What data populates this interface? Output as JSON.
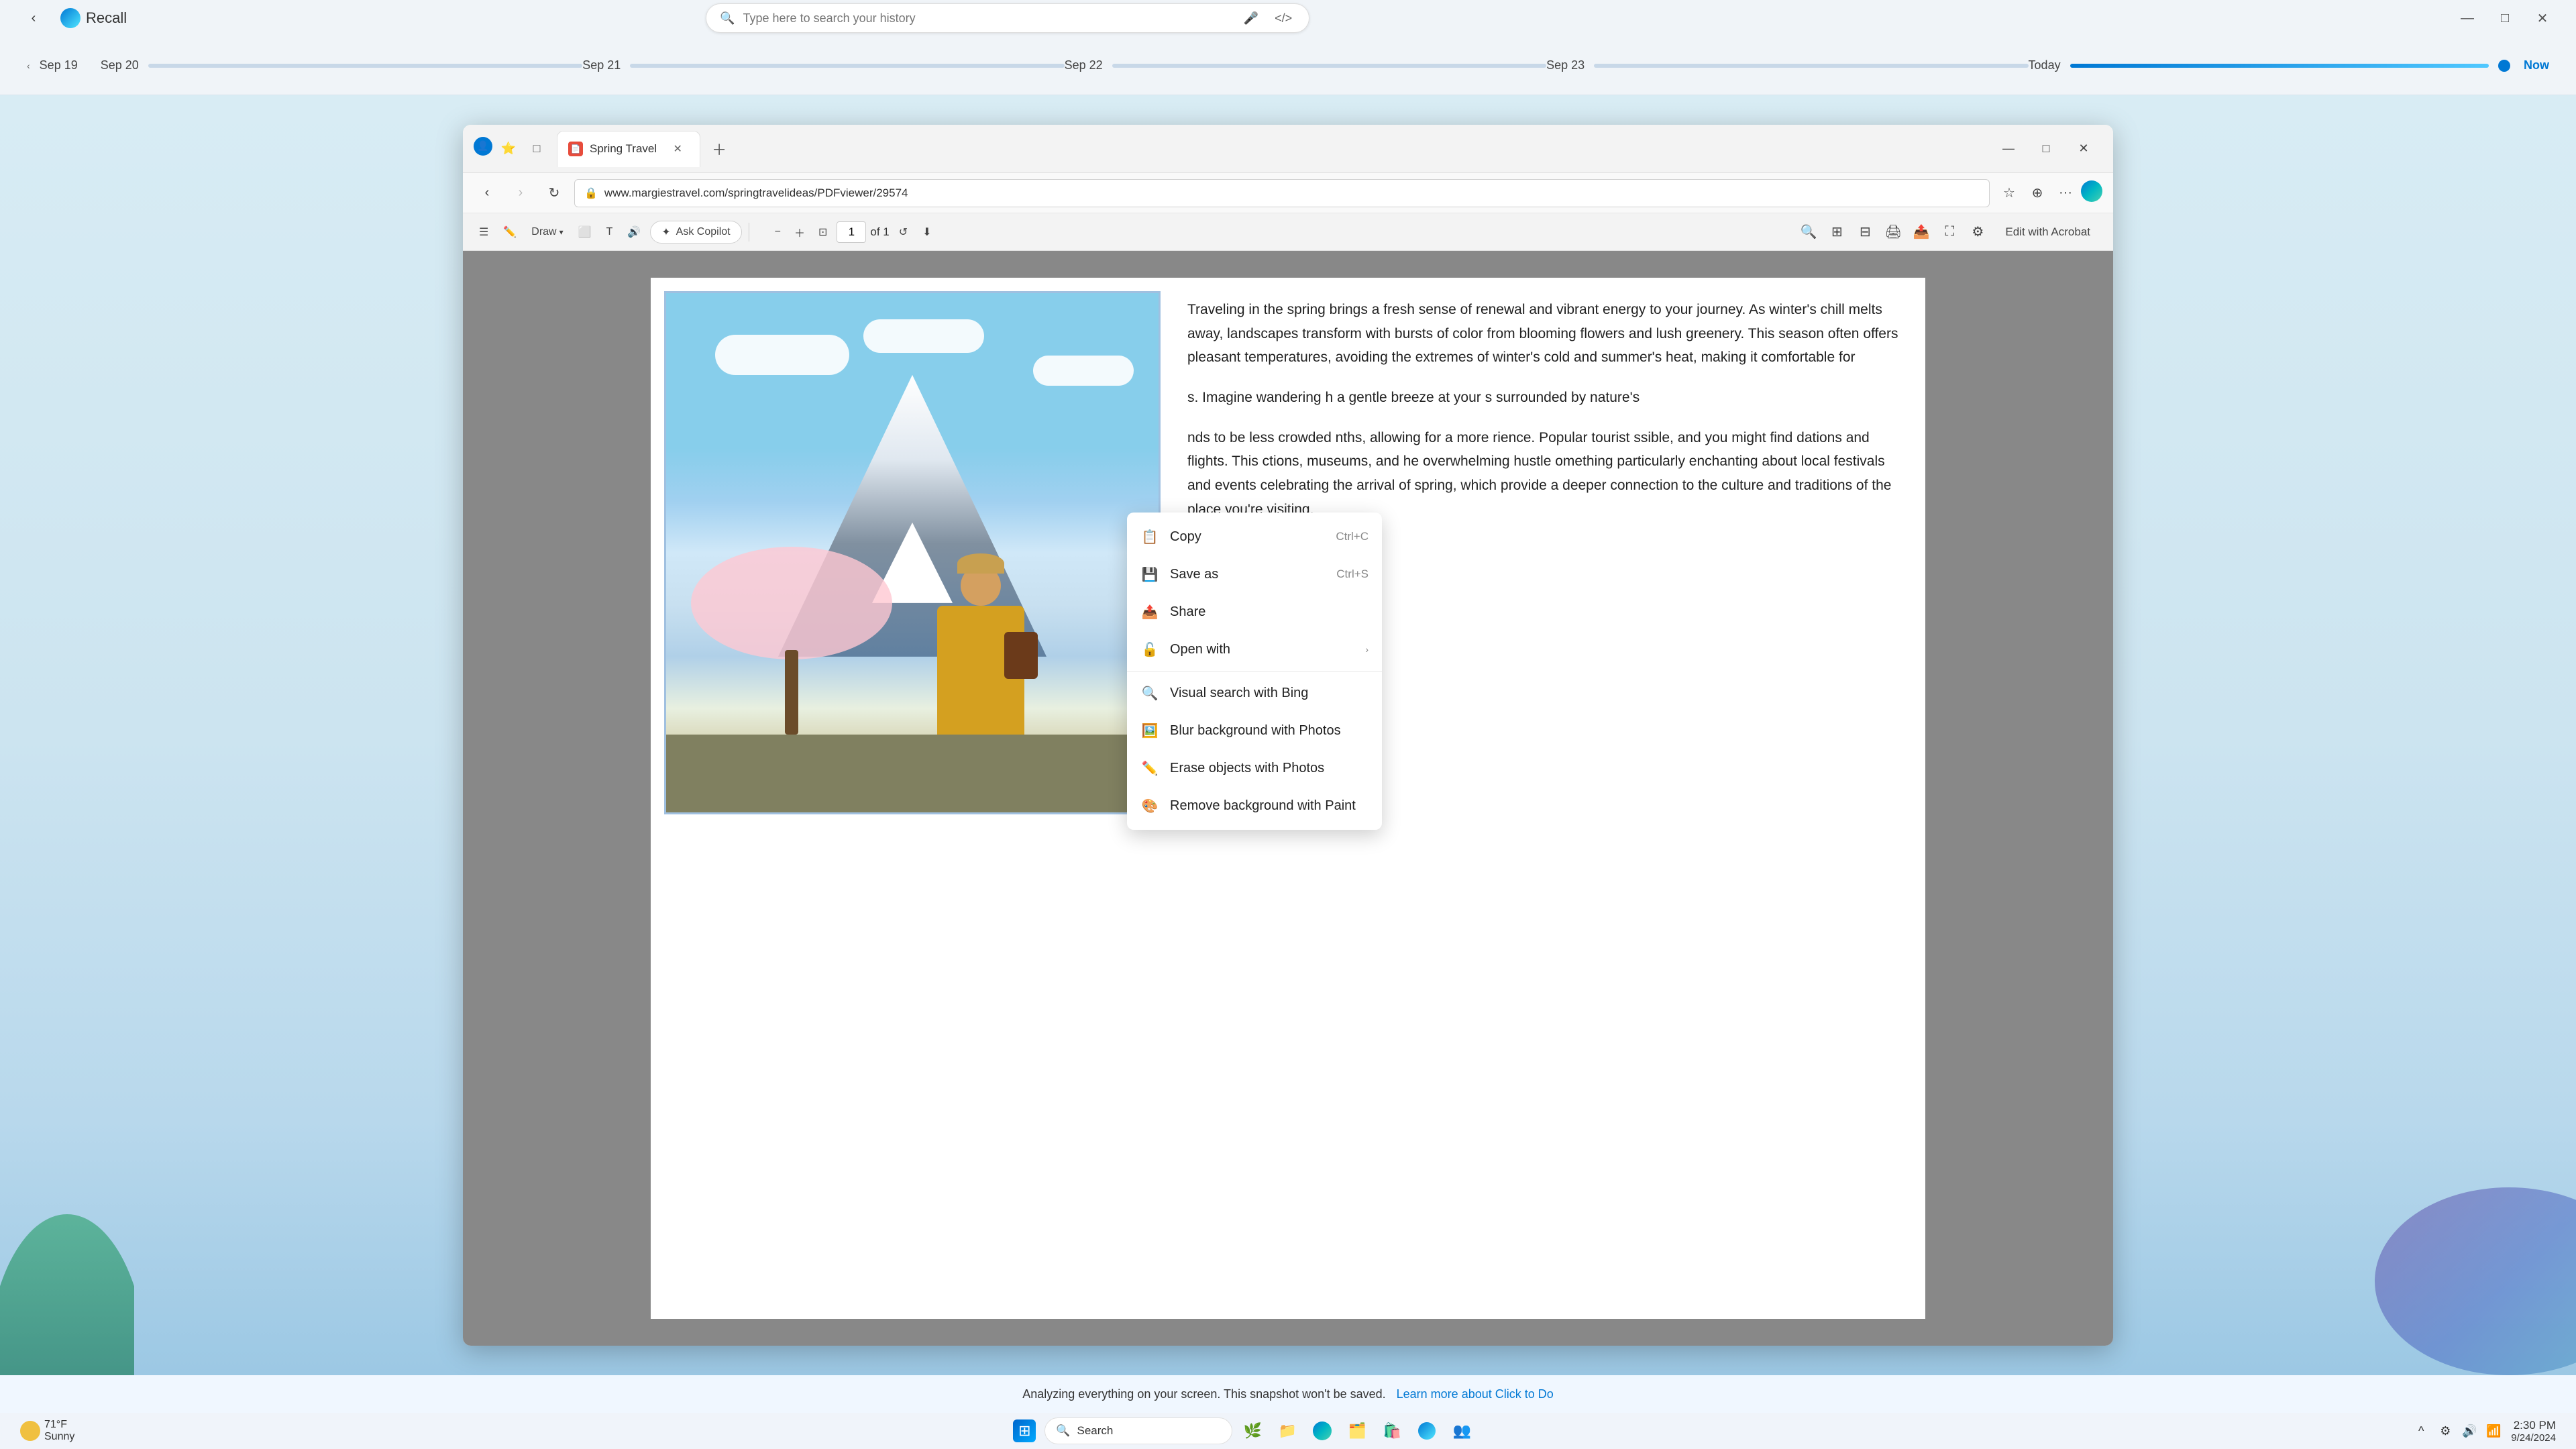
{
  "recall": {
    "app_title": "Recall",
    "search_placeholder": "Type here to search your history",
    "timeline": {
      "items": [
        {
          "label": "Sep 19",
          "has_prev": true
        },
        {
          "label": "Sep 20"
        },
        {
          "label": "Sep 21"
        },
        {
          "label": "Sep 22"
        },
        {
          "label": "Sep 23"
        },
        {
          "label": "Today"
        }
      ],
      "now_label": "Now"
    }
  },
  "browser": {
    "tab_title": "Spring Travel",
    "address": "www.margiestravel.com/springtravelideas/PDFviewer/29574",
    "pdf_toolbar": {
      "draw_label": "Draw",
      "ask_copilot_label": "Ask Copilot",
      "page_current": "1",
      "page_total": "of 1",
      "edit_acrobat_label": "Edit with Acrobat"
    }
  },
  "pdf_content": {
    "paragraph1": "Traveling in the spring brings a fresh sense of renewal and vibrant energy to your journey. As winter's chill melts away, landscapes transform with bursts of color from blooming flowers and lush greenery. This season often offers pleasant temperatures, avoiding the extremes of winter's cold and summer's heat, making it comfortable for",
    "paragraph1_cont": "s. Imagine wandering h a gentle breeze at your s surrounded by nature's",
    "paragraph2": "nds to be less crowded nths, allowing for a more rience. Popular tourist ssible, and you might find dations and flights. This ctions, museums, and he overwhelming hustle omething particularly enchanting about local festivals and events celebrating the arrival of spring, which provide a deeper connection to the culture and traditions of the place you're visiting."
  },
  "context_menu": {
    "items": [
      {
        "icon": "📋",
        "label": "Copy",
        "shortcut": "Ctrl+C",
        "has_arrow": false
      },
      {
        "icon": "💾",
        "label": "Save as",
        "shortcut": "Ctrl+S",
        "has_arrow": false
      },
      {
        "icon": "📤",
        "label": "Share",
        "shortcut": "",
        "has_arrow": false
      },
      {
        "icon": "🔓",
        "label": "Open with",
        "shortcut": "",
        "has_arrow": true
      },
      {
        "icon": "🔍",
        "label": "Visual search with Bing",
        "shortcut": "",
        "has_arrow": false,
        "divider_before": true
      },
      {
        "icon": "🖼️",
        "label": "Blur background with Photos",
        "shortcut": "",
        "has_arrow": false
      },
      {
        "icon": "✏️",
        "label": "Erase objects with Photos",
        "shortcut": "",
        "has_arrow": false
      },
      {
        "icon": "🎨",
        "label": "Remove background with Paint",
        "shortcut": "",
        "has_arrow": false
      }
    ]
  },
  "status_bar": {
    "analyzing_text": "Analyzing everything on your screen. This snapshot won't be saved.",
    "learn_more_label": "Learn more about Click to Do"
  },
  "taskbar": {
    "weather_temp": "71°F",
    "weather_desc": "Sunny",
    "search_placeholder": "Search",
    "clock_time": "2:30 PM",
    "clock_date": "9/24/2024"
  }
}
